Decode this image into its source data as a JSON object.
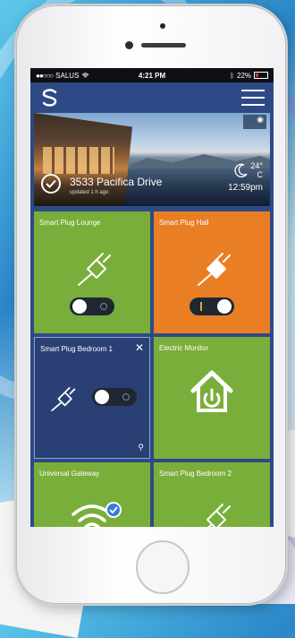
{
  "status_bar": {
    "carrier": "SALUS",
    "time": "4:21 PM",
    "battery": "22%"
  },
  "hero": {
    "address": "3533 Pacifica Drive",
    "updated": "updated 1 h ago",
    "temperature": "24°",
    "temperature_unit": "C",
    "time": "12:59pm"
  },
  "tiles": [
    {
      "title": "Smart Plug Lounge",
      "icon": "plug-icon",
      "toggle": "off",
      "color": "#7aae3a"
    },
    {
      "title": "Smart Plug Hall",
      "icon": "plug-icon",
      "toggle": "on",
      "color": "#ea7e24"
    },
    {
      "title": "Smart Plug Bedroom 1",
      "icon": "plug-icon",
      "toggle": "off",
      "color": "#2a3f74"
    },
    {
      "title": "Electric Monitor",
      "icon": "house-power-icon",
      "color": "#7aae3a"
    },
    {
      "title": "Universal Gateway",
      "icon": "wifi-icon",
      "color": "#7aae3a"
    },
    {
      "title": "Smart Plug Bedroom 2",
      "icon": "plug-icon",
      "color": "#7aae3a"
    }
  ],
  "colors": {
    "screen_bg": "#2e4a86",
    "tile_green": "#7aae3a",
    "tile_orange": "#ea7e24",
    "tile_navy": "#2a3f74"
  }
}
